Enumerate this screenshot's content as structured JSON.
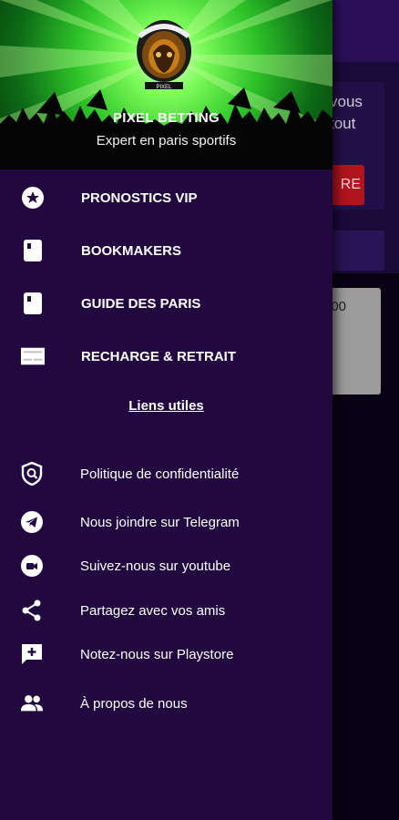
{
  "background": {
    "text_line1": "vous",
    "text_line2": "tout",
    "button_label": "RE",
    "card_value": "00"
  },
  "drawer": {
    "app_title": "PIXEL BETTING",
    "app_subtitle": "Expert en paris sportifs",
    "logo_text": "PIXEL",
    "menu": [
      {
        "label": "PRONOSTICS VIP",
        "icon": "star-circle-icon"
      },
      {
        "label": "BOOKMAKERS",
        "icon": "book-icon"
      },
      {
        "label": "GUIDE DES PARIS",
        "icon": "book-icon"
      },
      {
        "label": "RECHARGE & RETRAIT",
        "icon": "card-icon"
      }
    ],
    "links_title": "Liens utiles",
    "links": [
      {
        "label": "Politique de confidentialité",
        "icon": "shield-search-icon"
      },
      {
        "label": "Nous joindre sur Telegram",
        "icon": "telegram-icon"
      },
      {
        "label": "Suivez-nous sur youtube",
        "icon": "video-chat-icon"
      },
      {
        "label": "Partagez avec vos amis",
        "icon": "share-icon"
      },
      {
        "label": "Notez-nous sur Playstore",
        "icon": "rate-review-icon"
      },
      {
        "label": "À propos de nous",
        "icon": "people-icon"
      }
    ]
  },
  "colors": {
    "drawer_bg": "#21083f",
    "header_green": "#2fc42a",
    "accent_red": "#b0141d"
  }
}
